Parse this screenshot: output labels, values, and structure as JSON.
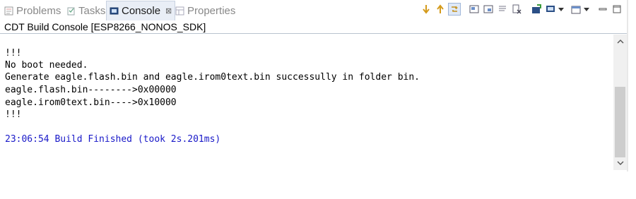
{
  "tabs": [
    {
      "label": "Problems",
      "icon": "problems-icon",
      "active": false
    },
    {
      "label": "Tasks",
      "icon": "tasks-icon",
      "active": false
    },
    {
      "label": "Console",
      "icon": "console-icon",
      "active": true
    },
    {
      "label": "Properties",
      "icon": "properties-icon",
      "active": false
    }
  ],
  "close_glyph": "⊠",
  "toolbar_icons": [
    "scroll-down-icon",
    "scroll-up-icon",
    "link-icon",
    "pin-icon",
    "display-selected-icon",
    "clear-icon",
    "copy-icon",
    "open-console-icon",
    "console-dropdown-icon",
    "minimize-icon",
    "maximize-icon"
  ],
  "console": {
    "name": "CDT Build Console [ESP8266_NONOS_SDK]",
    "lines": [
      {
        "text": "!!!",
        "type": "normal"
      },
      {
        "text": "No boot needed.",
        "type": "normal"
      },
      {
        "text": "Generate eagle.flash.bin and eagle.irom0text.bin successully in folder bin.",
        "type": "normal"
      },
      {
        "text": "eagle.flash.bin-------->0x00000",
        "type": "normal"
      },
      {
        "text": "eagle.irom0text.bin---->0x10000",
        "type": "normal"
      },
      {
        "text": "!!!",
        "type": "normal"
      },
      {
        "text": "",
        "type": "normal"
      },
      {
        "text": "23:06:54 Build Finished (took 2s.201ms)",
        "type": "info"
      }
    ]
  },
  "colors": {
    "info_text": "#1818c8",
    "active_tab_bg": "#e9eef6"
  }
}
